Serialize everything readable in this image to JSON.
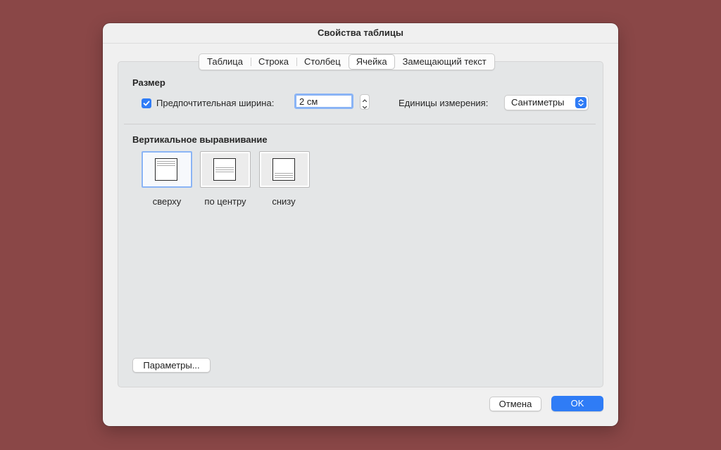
{
  "dialog": {
    "title": "Свойства таблицы"
  },
  "tabs": [
    {
      "label": "Таблица",
      "active": false
    },
    {
      "label": "Строка",
      "active": false
    },
    {
      "label": "Столбец",
      "active": false
    },
    {
      "label": "Ячейка",
      "active": true
    },
    {
      "label": "Замещающий текст",
      "active": false
    }
  ],
  "size": {
    "heading": "Размер",
    "preferred_width_checked": true,
    "preferred_width_label": "Предпочтительная ширина:",
    "preferred_width_value": "2 см",
    "units_label": "Единицы измерения:",
    "units_value": "Сантиметры"
  },
  "vertical_alignment": {
    "heading": "Вертикальное выравнивание",
    "options": [
      {
        "caption": "сверху",
        "selected": true,
        "icon": "align-top-icon"
      },
      {
        "caption": "по центру",
        "selected": false,
        "icon": "align-center-icon"
      },
      {
        "caption": "снизу",
        "selected": false,
        "icon": "align-bottom-icon"
      }
    ]
  },
  "buttons": {
    "options_label": "Параметры...",
    "cancel_label": "Отмена",
    "ok_label": "OK"
  },
  "colors": {
    "background": "#8a4747",
    "accent": "#2f7cf6",
    "selection_ring": "#8ab4f5"
  }
}
